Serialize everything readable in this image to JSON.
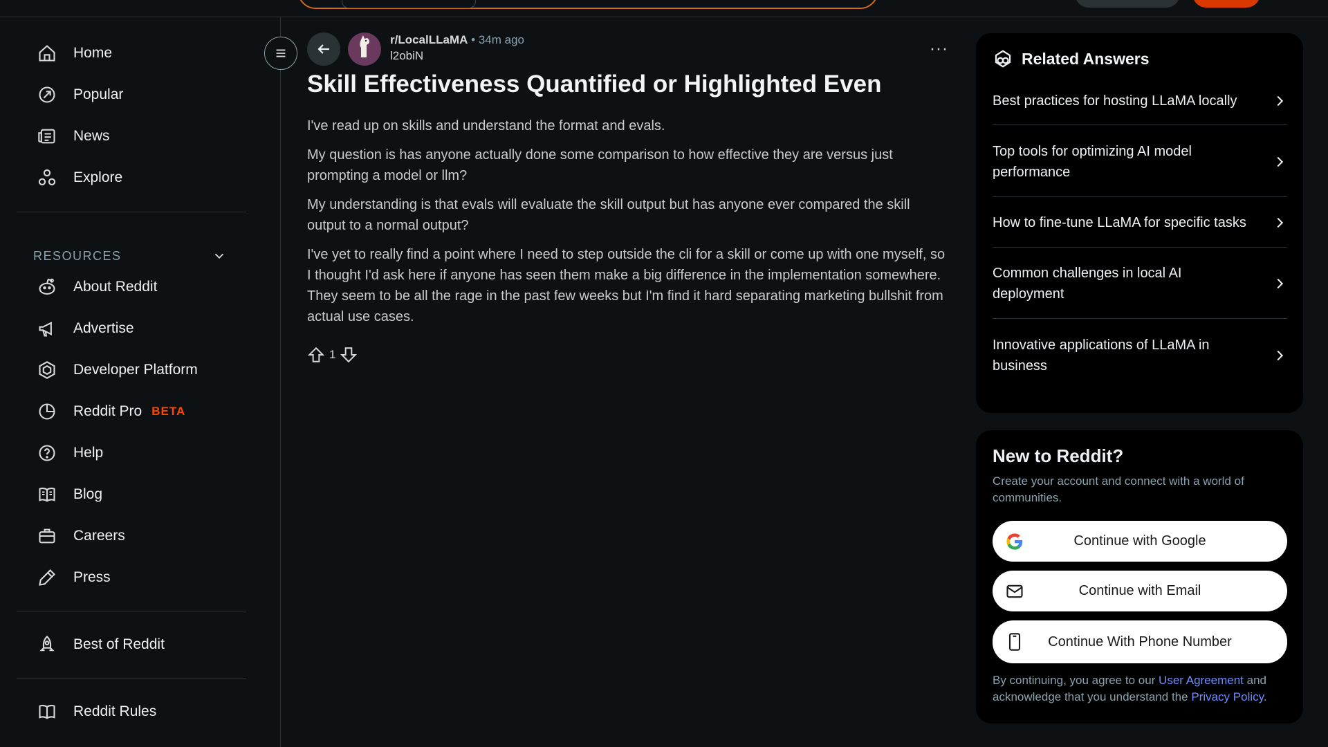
{
  "sidebar": {
    "items": [
      {
        "label": "Home",
        "icon": "home-icon"
      },
      {
        "label": "Popular",
        "icon": "popular-icon"
      },
      {
        "label": "News",
        "icon": "news-icon"
      },
      {
        "label": "Explore",
        "icon": "explore-icon"
      }
    ],
    "resources_header": "RESOURCES",
    "resources": [
      {
        "label": "About Reddit",
        "icon": "reddit-icon"
      },
      {
        "label": "Advertise",
        "icon": "megaphone-icon"
      },
      {
        "label": "Developer Platform",
        "icon": "developer-icon"
      },
      {
        "label": "Reddit Pro",
        "icon": "pro-icon",
        "badge": "BETA"
      },
      {
        "label": "Help",
        "icon": "help-icon"
      },
      {
        "label": "Blog",
        "icon": "blog-icon"
      },
      {
        "label": "Careers",
        "icon": "briefcase-icon"
      },
      {
        "label": "Press",
        "icon": "pen-icon"
      }
    ],
    "best_of": "Best of Reddit",
    "rules": "Reddit Rules"
  },
  "post": {
    "subreddit": "r/LocalLLaMA",
    "time": "• 34m ago",
    "author": "l2obiN",
    "title": "Skill Effectiveness Quantified or Highlighted Even",
    "paragraphs": [
      "I've read up on skills and understand the format and evals.",
      "My question is has anyone actually done some comparison to how effective they are versus just prompting a model or llm?",
      "My understanding is that evals will evaluate the skill output but has anyone ever compared the skill output to a normal output?",
      "I've yet to really find a point where I need to step outside the cli for a skill or come up with one myself, so I thought I'd ask here if anyone has seen them make a big difference in the implementation somewhere. They seem to be all the rage in the past few weeks but I'm find it hard separating marketing bullshit from actual use cases."
    ],
    "votes": "1",
    "more": "···"
  },
  "related": {
    "title": "Related Answers",
    "items": [
      "Best practices for hosting LLaMA locally",
      "Top tools for optimizing AI model performance",
      "How to fine-tune LLaMA for specific tasks",
      "Common challenges in local AI deployment",
      "Innovative applications of LLaMA in business"
    ]
  },
  "signup": {
    "title": "New to Reddit?",
    "subtitle": "Create your account and connect with a world of communities.",
    "google": "Continue with Google",
    "email": "Continue with Email",
    "phone": "Continue With Phone Number",
    "legal_pre": "By continuing, you agree to our ",
    "legal_link1": "User Agreement",
    "legal_mid": " and acknowledge that you understand the ",
    "legal_link2": "Privacy Policy",
    "legal_post": "."
  },
  "colors": {
    "background": "#0e1113",
    "accent": "#ff4500",
    "link": "#6d8eff"
  }
}
